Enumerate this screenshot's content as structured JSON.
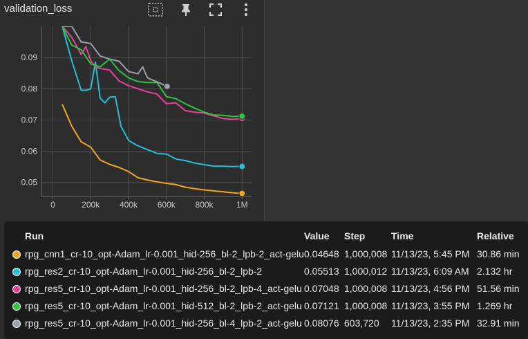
{
  "panel": {
    "title": "validation_loss",
    "icons": [
      "select-region-icon",
      "pin-icon",
      "fullscreen-icon",
      "more-vert-icon"
    ]
  },
  "chart_data": {
    "type": "line",
    "title": "validation_loss",
    "xlim": [
      -60000,
      1050000
    ],
    "ylim": [
      0.0455,
      0.1
    ],
    "x_ticks": [
      0,
      200000,
      400000,
      600000,
      800000,
      1000000
    ],
    "x_tick_labels": [
      "0",
      "200k",
      "400k",
      "600k",
      "800k",
      "1M"
    ],
    "y_ticks": [
      0.05,
      0.06,
      0.07,
      0.08,
      0.09
    ],
    "y_tick_labels": [
      "0.05",
      "0.06",
      "0.07",
      "0.08",
      "0.09"
    ],
    "grid": true,
    "series": [
      {
        "name": "rpg_cnn1_cr-10_opt-Adam_lr-0.001_hid-256_bl-2_lpb-2_act-gelu",
        "color": "#f2a622",
        "x": [
          50000,
          100000,
          150000,
          200000,
          250000,
          300000,
          350000,
          400000,
          450000,
          500000,
          550000,
          600000,
          650000,
          700000,
          750000,
          800000,
          850000,
          900000,
          950000,
          1000008
        ],
        "y": [
          0.075,
          0.068,
          0.063,
          0.0613,
          0.0572,
          0.0558,
          0.0548,
          0.0535,
          0.0515,
          0.0508,
          0.0502,
          0.0497,
          0.0493,
          0.0485,
          0.048,
          0.0476,
          0.0473,
          0.047,
          0.0467,
          0.04648
        ]
      },
      {
        "name": "rpg_res2_cr-10_opt-Adam_lr-0.001_hid-256_bl-2_lpb-2",
        "color": "#26bfd6",
        "x": [
          50000,
          100000,
          150000,
          175000,
          200000,
          225000,
          250000,
          275000,
          300000,
          330000,
          360000,
          400000,
          440000,
          500000,
          550000,
          600000,
          650000,
          700000,
          750000,
          800000,
          850000,
          900000,
          950000,
          1000012
        ],
        "y": [
          0.1,
          0.089,
          0.0795,
          0.0795,
          0.08,
          0.0885,
          0.077,
          0.0755,
          0.0773,
          0.0775,
          0.068,
          0.0635,
          0.062,
          0.0605,
          0.0593,
          0.0591,
          0.0575,
          0.057,
          0.0562,
          0.0557,
          0.0552,
          0.0552,
          0.0551,
          0.05513
        ]
      },
      {
        "name": "rpg_res5_cr-10_opt-Adam_lr-0.001_hid-256_bl-4_lpb-2_act-gelu",
        "color": "#e64396",
        "x": [
          50000,
          100000,
          150000,
          175000,
          200000,
          225000,
          250000,
          300000,
          350000,
          400000,
          450000,
          500000,
          550000,
          600000,
          650000,
          700000,
          750000,
          800000,
          850000,
          900000,
          950000,
          1000008
        ],
        "y": [
          0.1,
          0.0965,
          0.091,
          0.0935,
          0.089,
          0.087,
          0.0865,
          0.086,
          0.0825,
          0.081,
          0.08,
          0.079,
          0.0783,
          0.0752,
          0.0755,
          0.073,
          0.0725,
          0.0722,
          0.0713,
          0.0705,
          0.0702,
          0.07048
        ]
      },
      {
        "name": "rpg_res5_cr-10_opt-Adam_lr-0.001_hid-512_bl-2_lpb-2_act-gelu",
        "color": "#2fc244",
        "x": [
          50000,
          100000,
          150000,
          200000,
          250000,
          300000,
          350000,
          400000,
          450000,
          500000,
          550000,
          600000,
          650000,
          700000,
          750000,
          800000,
          850000,
          900000,
          950000,
          1000008
        ],
        "y": [
          0.1,
          0.094,
          0.0925,
          0.088,
          0.087,
          0.0895,
          0.0858,
          0.0835,
          0.0823,
          0.082,
          0.082,
          0.0775,
          0.0768,
          0.0752,
          0.0738,
          0.0725,
          0.0716,
          0.0715,
          0.0711,
          0.07121
        ]
      },
      {
        "name": "rpg_res5_cr-10_opt-Adam_lr-0.001_hid-256_bl-4_lpb-2_act-gelu",
        "color": "#9aa0a6",
        "x": [
          50000,
          100000,
          150000,
          200000,
          250000,
          300000,
          350000,
          400000,
          450000,
          475000,
          500000,
          550000,
          603720
        ],
        "y": [
          0.1,
          0.1,
          0.095,
          0.0945,
          0.0905,
          0.0895,
          0.0888,
          0.0855,
          0.0848,
          0.087,
          0.0835,
          0.0822,
          0.08076
        ]
      }
    ]
  },
  "table": {
    "headers": [
      "Run",
      "Value",
      "Step",
      "Time",
      "Relative"
    ],
    "rows": [
      {
        "color": "#f2a622",
        "run": "rpg_cnn1_cr-10_opt-Adam_lr-0.001_hid-256_bl-2_lpb-2_act-gelu",
        "value": "0.04648",
        "step": "1,000,008",
        "time": "11/13/23, 5:45 PM",
        "relative": "30.86 min"
      },
      {
        "color": "#26bfd6",
        "run": "rpg_res2_cr-10_opt-Adam_lr-0.001_hid-256_bl-2_lpb-2",
        "value": "0.05513",
        "step": "1,000,012",
        "time": "11/13/23, 6:09 AM",
        "relative": "2.132 hr"
      },
      {
        "color": "#e64396",
        "run": "rpg_res5_cr-10_opt-Adam_lr-0.001_hid-256_bl-2_lpb-4_act-gelu",
        "value": "0.07048",
        "step": "1,000,008",
        "time": "11/13/23, 4:56 PM",
        "relative": "51.56 min"
      },
      {
        "color": "#2fc244",
        "run": "rpg_res5_cr-10_opt-Adam_lr-0.001_hid-512_bl-2_lpb-2_act-gelu",
        "value": "0.07121",
        "step": "1,000,008",
        "time": "11/13/23, 3:55 PM",
        "relative": "1.269 hr"
      },
      {
        "color": "#9aa0a6",
        "run": "rpg_res5_cr-10_opt-Adam_lr-0.001_hid-256_bl-4_lpb-2_act-gelu",
        "value": "0.08076",
        "step": "603,720",
        "time": "11/13/23, 2:35 PM",
        "relative": "32.91 min"
      }
    ]
  }
}
